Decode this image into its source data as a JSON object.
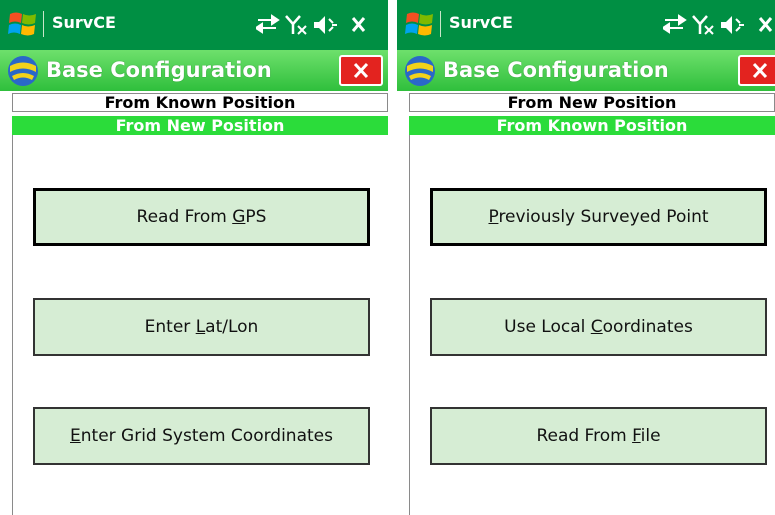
{
  "screens": [
    {
      "status": {
        "app_name": "SurvCE"
      },
      "header": {
        "title": "Base Configuration"
      },
      "tabs": {
        "top": "From Known Position",
        "active": "From New Position"
      },
      "buttons": [
        {
          "before": "Read From ",
          "accel": "G",
          "after": "PS"
        },
        {
          "before": "Enter ",
          "accel": "L",
          "after": "at/Lon"
        },
        {
          "before": "",
          "accel": "E",
          "after": "nter Grid System Coordinates"
        }
      ]
    },
    {
      "status": {
        "app_name": "SurvCE"
      },
      "header": {
        "title": "Base Configuration"
      },
      "tabs": {
        "top": "From New Position",
        "active": "From Known Position"
      },
      "buttons": [
        {
          "before": "",
          "accel": "P",
          "after": "reviously Surveyed Point"
        },
        {
          "before": "Use Local ",
          "accel": "C",
          "after": "oordinates"
        },
        {
          "before": "Read From ",
          "accel": "F",
          "after": "ile"
        }
      ]
    }
  ],
  "icons": {
    "start": "windows-start-icon",
    "connectivity": "sync-arrows-icon",
    "signal": "antenna-no-signal-icon",
    "volume": "speaker-muted-icon",
    "close_status": "close-icon",
    "app": "survce-logo-icon",
    "close_window": "close-window-icon"
  },
  "colors": {
    "titlebar": "#008f43",
    "header_gradient_top": "#6ee06c",
    "header_gradient_bottom": "#2fbf3c",
    "active_tab": "#2bdc3a",
    "button_fill": "#d6edd4",
    "close_button": "#e3231f"
  }
}
